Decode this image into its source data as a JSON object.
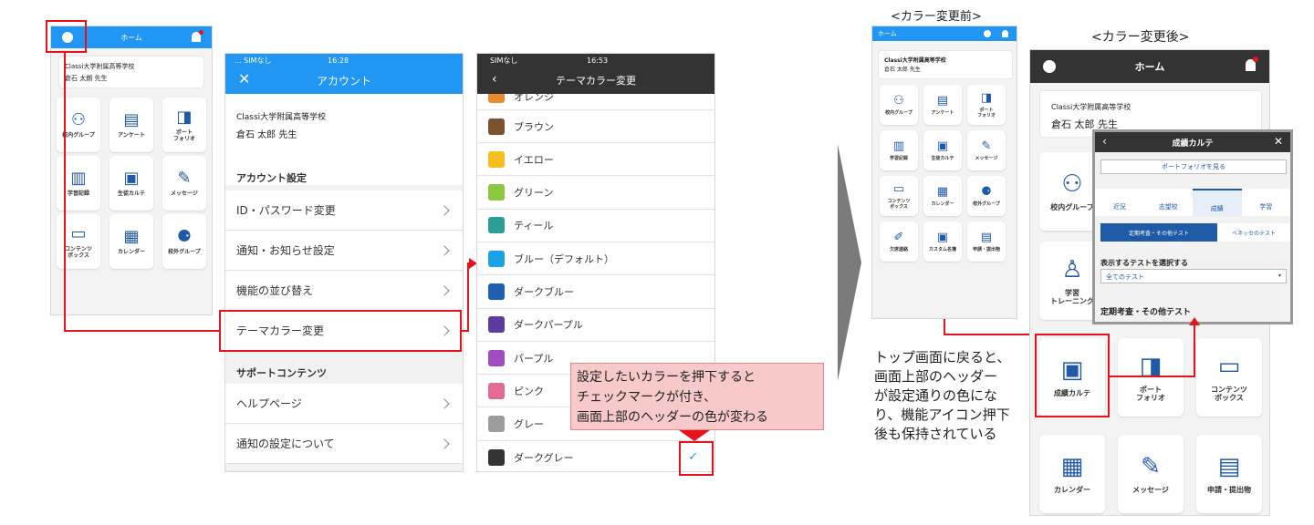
{
  "screen1": {
    "title": "ホーム",
    "school": "Classi大学附属高等学校",
    "user": "倉石 太朗 先生",
    "tiles": [
      {
        "label": "校内グループ",
        "icon": "group-icon",
        "g": "⚇"
      },
      {
        "label": "アンケート",
        "icon": "survey-icon",
        "g": "▤"
      },
      {
        "label": "ポート\nフォリオ",
        "icon": "portfolio-icon",
        "g": "◨"
      },
      {
        "label": "学習記録",
        "icon": "chart-icon",
        "g": "▥"
      },
      {
        "label": "生徒カルテ",
        "icon": "student-card-icon",
        "g": "▣"
      },
      {
        "label": "メッセージ",
        "icon": "message-icon",
        "g": "✎"
      },
      {
        "label": "コンテンツ\nボックス",
        "icon": "box-icon",
        "g": "▭"
      },
      {
        "label": "カレンダー",
        "icon": "calendar-icon",
        "g": "▦"
      },
      {
        "label": "校外グループ",
        "icon": "outer-group-icon",
        "g": "⚈"
      }
    ]
  },
  "screen2": {
    "carrier": "... SIMなし",
    "time": "16:28",
    "title": "アカウント",
    "school": "Classi大学附属高等学校",
    "user": "倉石 太郎 先生",
    "section1": "アカウント設定",
    "items1": [
      "ID・パスワード変更",
      "通知・お知らせ設定",
      "機能の並び替え",
      "テーマカラー変更"
    ],
    "section2": "サポートコンテンツ",
    "items2": [
      "ヘルプページ",
      "通知の設定について"
    ]
  },
  "screen3": {
    "carrier": "SIMなし",
    "time": "16:53",
    "title": "テーマカラー変更",
    "partial": "オレンジ",
    "colors": [
      {
        "name": "ブラウン",
        "color": "#7b5230"
      },
      {
        "name": "イエロー",
        "color": "#f2c018"
      },
      {
        "name": "グリーン",
        "color": "#8dc63f"
      },
      {
        "name": "ティール",
        "color": "#2a9d95"
      },
      {
        "name": "ブルー（デフォルト）",
        "color": "#1aa3e8"
      },
      {
        "name": "ダークブルー",
        "color": "#1f5fb5"
      },
      {
        "name": "ダークパープル",
        "color": "#5b3b9e"
      },
      {
        "name": "パープル",
        "color": "#a14bc3"
      },
      {
        "name": "ピンク",
        "color": "#e26a93"
      },
      {
        "name": "グレー",
        "color": "#9c9c9c"
      },
      {
        "name": "ダークグレー",
        "color": "#333333"
      }
    ],
    "check": "✓"
  },
  "callout": {
    "lines": [
      "設定したいカラーを押下すると",
      "チェックマークが付き、",
      "画面上部のヘッダーの色が変わる"
    ]
  },
  "before": {
    "caption": "<カラー変更前>",
    "title": "ホーム",
    "school": "Classi大学附属高等学校",
    "user": "倉石 太郎 先生",
    "tiles": [
      {
        "label": "校内グループ",
        "icon": "group-icon",
        "g": "⚇"
      },
      {
        "label": "アンケート",
        "icon": "survey-icon",
        "g": "▤"
      },
      {
        "label": "ポート\nフォリオ",
        "icon": "portfolio-icon",
        "g": "◨"
      },
      {
        "label": "学習記録",
        "icon": "chart-icon",
        "g": "▥"
      },
      {
        "label": "生徒カルテ",
        "icon": "student-card-icon",
        "g": "▣"
      },
      {
        "label": "メッセージ",
        "icon": "message-icon",
        "g": "✎"
      },
      {
        "label": "コンテンツ\nボックス",
        "icon": "box-icon",
        "g": "▭"
      },
      {
        "label": "カレンダー",
        "icon": "calendar-icon",
        "g": "▦"
      },
      {
        "label": "校外グループ",
        "icon": "outer-group-icon",
        "g": "⚈"
      },
      {
        "label": "欠席連絡",
        "icon": "absence-icon",
        "g": "✐"
      },
      {
        "label": "カスタム名簿",
        "icon": "roster-icon",
        "g": "▣"
      },
      {
        "label": "申請・提出物",
        "icon": "submission-icon",
        "g": "▤"
      }
    ]
  },
  "note": {
    "lines": [
      "トップ画面に戻ると、",
      "画面上部のヘッダー",
      "が設定通りの色にな",
      "り、機能アイコン押下",
      "後も保持されている"
    ]
  },
  "after": {
    "caption": "<カラー変更後>",
    "title": "ホーム",
    "school": "Classi大学附属高等学校",
    "user": "倉石 太郎 先生",
    "tiles": [
      {
        "label": "校内グループ",
        "icon": "group-icon",
        "g": "⚇"
      },
      {
        "label": "学習\nトレーニング",
        "icon": "training-icon",
        "g": "♙"
      },
      {
        "label": "成績カルテ",
        "icon": "grade-card-icon",
        "g": "▣"
      },
      {
        "label": "ポート\nフォリオ",
        "icon": "portfolio-icon",
        "g": "◨"
      },
      {
        "label": "コンテンツ\nボックス",
        "icon": "box-icon",
        "g": "▭"
      },
      {
        "label": "カレンダー",
        "icon": "calendar-icon",
        "g": "▦"
      },
      {
        "label": "メッセージ",
        "icon": "message-icon",
        "g": "✎"
      },
      {
        "label": "申請・提出物",
        "icon": "submission-icon",
        "g": "▤"
      }
    ]
  },
  "popup": {
    "title": "成績カルテ",
    "button": "ポートフォリオを見る",
    "tabs": [
      "近況",
      "志望校",
      "成績",
      "学習"
    ],
    "subtabs": [
      "定期考査・その他テスト",
      "ベネッセのテスト"
    ],
    "select_label": "表示するテストを選択する",
    "select_value": "全てのテスト",
    "section": "定期考査・その他テスト"
  },
  "colors": {
    "blue": "#2196f3",
    "dark": "#333333",
    "red": "#e8121b"
  }
}
